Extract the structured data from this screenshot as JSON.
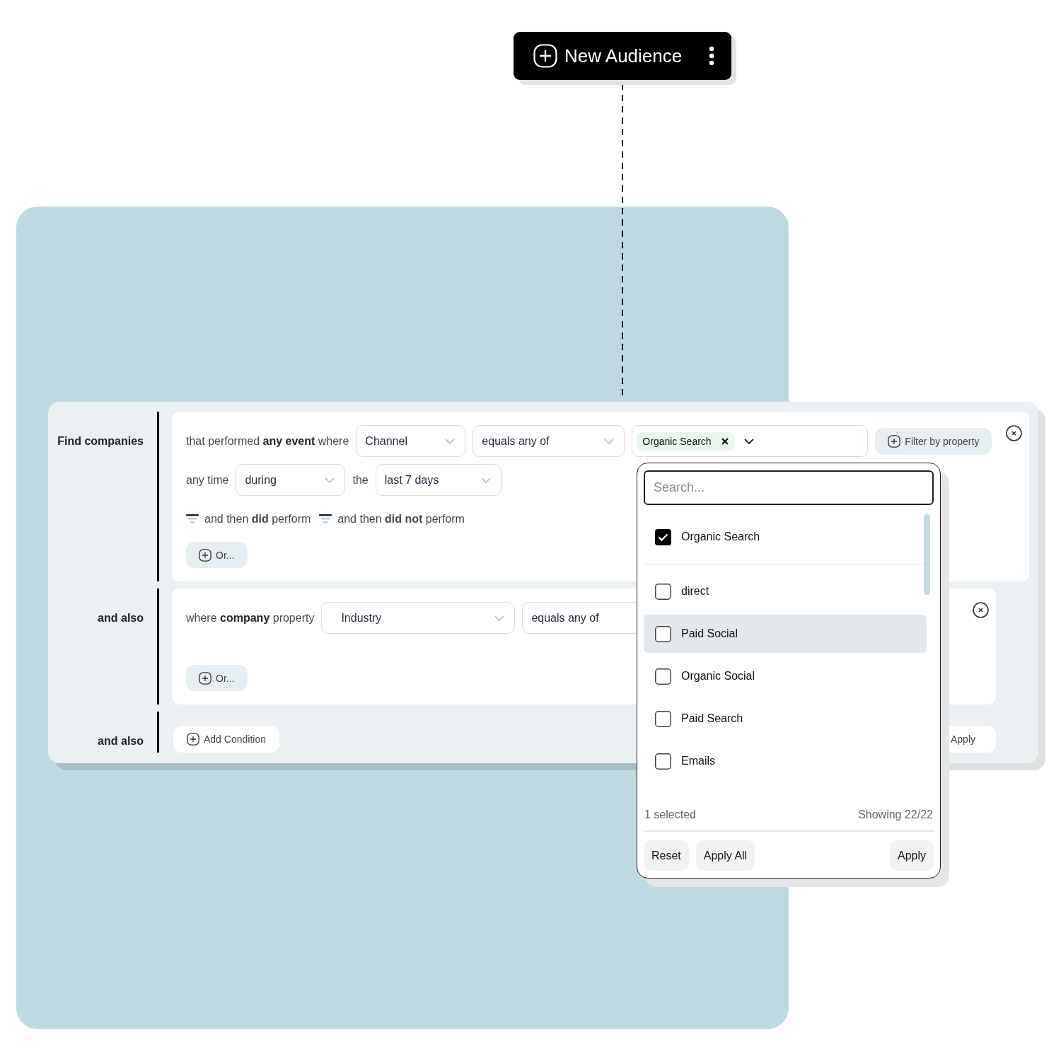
{
  "new_audience_button": {
    "label": "New Audience"
  },
  "groups": [
    {
      "label": "Find companies",
      "kind": "event",
      "intro": "that performed **any event** where",
      "property": "Channel",
      "operator": "equals any of",
      "chips": [
        "Organic Search"
      ],
      "filter_button": "Filter by property",
      "time_prefix": "any time",
      "time_mode": "during",
      "time_joiner": "the",
      "time_range": "last 7 days",
      "sequence_links": [
        "and then **did** perform",
        "and then **did not** perform"
      ],
      "or_button": "Or..."
    },
    {
      "label": "and also",
      "kind": "property",
      "intro": "where **company** property",
      "property": "Industry",
      "operator": "equals any of",
      "or_button": "Or..."
    },
    {
      "label": "and also",
      "kind": "add",
      "add_button": "Add Condition",
      "apply_button": "Apply"
    }
  ],
  "dropdown": {
    "search_placeholder": "Search...",
    "options": [
      {
        "label": "Organic Search",
        "checked": true,
        "highlighted": false
      },
      {
        "label": "direct",
        "checked": false,
        "highlighted": false
      },
      {
        "label": "Paid Social",
        "checked": false,
        "highlighted": true
      },
      {
        "label": "Organic Social",
        "checked": false,
        "highlighted": false
      },
      {
        "label": "Paid Search",
        "checked": false,
        "highlighted": false
      },
      {
        "label": "Emails",
        "checked": false,
        "highlighted": false
      }
    ],
    "selected_count": "1 selected",
    "showing": "Showing 22/22",
    "buttons": [
      "Reset",
      "Apply All",
      "Apply"
    ]
  }
}
